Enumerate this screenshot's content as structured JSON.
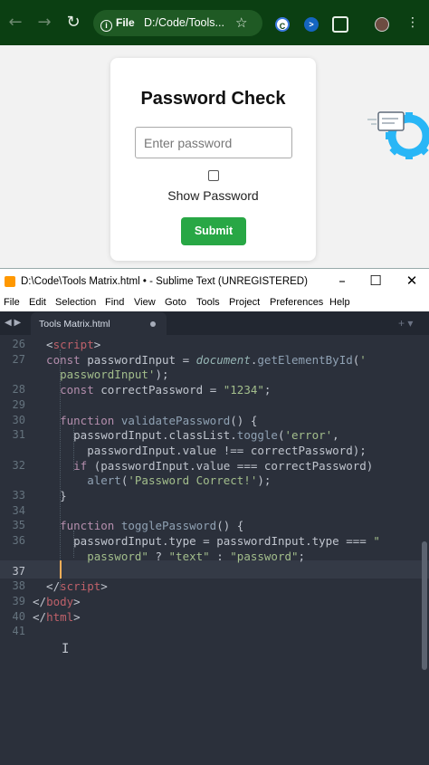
{
  "browser": {
    "url": "D:/Code/Tools...",
    "site_info": "File",
    "extension_c": "C"
  },
  "page": {
    "title": "Password Check",
    "password_placeholder": "Enter password",
    "show_password_label": "Show Password",
    "submit_label": "Submit"
  },
  "sublime": {
    "window_title": "D:\\Code\\Tools Matrix.html • - Sublime Text (UNREGISTERED)",
    "menu": [
      "File",
      "Edit",
      "Selection",
      "Find",
      "View",
      "Goto",
      "Tools",
      "Project",
      "Preferences",
      "Help"
    ],
    "tab_label": "Tools Matrix.html",
    "line_numbers": [
      "26",
      "27",
      "",
      "28",
      "29",
      "30",
      "31",
      "",
      "32",
      "",
      "33",
      "34",
      "35",
      "36",
      "",
      "37",
      "38",
      "39",
      "40",
      "41"
    ],
    "current_line": "37",
    "code": [
      [
        [
          "t-punc",
          "  <"
        ],
        [
          "t-tag",
          "script"
        ],
        [
          "t-punc",
          ">"
        ]
      ],
      [
        [
          "t-kw",
          "  const "
        ],
        [
          "t-var",
          "passwordInput "
        ],
        [
          "t-op",
          "= "
        ],
        [
          "t-it",
          "document"
        ],
        [
          "t-punc",
          "."
        ],
        [
          "t-fn",
          "getElementById"
        ],
        [
          "t-punc",
          "("
        ],
        [
          "t-str",
          "'"
        ]
      ],
      [
        [
          "t-str",
          "    passwordInput'"
        ],
        [
          "t-punc",
          ");"
        ]
      ],
      [
        [
          "t-kw",
          "    const "
        ],
        [
          "t-var",
          "correctPassword "
        ],
        [
          "t-op",
          "= "
        ],
        [
          "t-str",
          "\"1234\""
        ],
        [
          "t-punc",
          ";"
        ]
      ],
      [
        [
          "t-var",
          ""
        ]
      ],
      [
        [
          "t-kw",
          "    function "
        ],
        [
          "t-fn",
          "validatePassword"
        ],
        [
          "t-punc",
          "() {"
        ]
      ],
      [
        [
          "t-var",
          "      passwordInput"
        ],
        [
          "t-punc",
          "."
        ],
        [
          "t-var",
          "classList"
        ],
        [
          "t-punc",
          "."
        ],
        [
          "t-fn",
          "toggle"
        ],
        [
          "t-punc",
          "("
        ],
        [
          "t-str",
          "'error'"
        ],
        [
          "t-punc",
          ","
        ]
      ],
      [
        [
          "t-var",
          "        passwordInput"
        ],
        [
          "t-punc",
          "."
        ],
        [
          "t-var",
          "value "
        ],
        [
          "t-op",
          "!== "
        ],
        [
          "t-var",
          "correctPassword"
        ],
        [
          "t-punc",
          ");"
        ]
      ],
      [
        [
          "t-kw",
          "      if "
        ],
        [
          "t-punc",
          "("
        ],
        [
          "t-var",
          "passwordInput"
        ],
        [
          "t-punc",
          "."
        ],
        [
          "t-var",
          "value "
        ],
        [
          "t-op",
          "=== "
        ],
        [
          "t-var",
          "correctPassword"
        ],
        [
          "t-punc",
          ")"
        ]
      ],
      [
        [
          "t-fn",
          "        alert"
        ],
        [
          "t-punc",
          "("
        ],
        [
          "t-str",
          "'Password Correct!'"
        ],
        [
          "t-punc",
          ");"
        ]
      ],
      [
        [
          "t-punc",
          "    }"
        ]
      ],
      [
        [
          "t-var",
          ""
        ]
      ],
      [
        [
          "t-kw",
          "    function "
        ],
        [
          "t-fn",
          "togglePassword"
        ],
        [
          "t-punc",
          "() {"
        ]
      ],
      [
        [
          "t-var",
          "      passwordInput"
        ],
        [
          "t-punc",
          "."
        ],
        [
          "t-var",
          "type "
        ],
        [
          "t-op",
          "= "
        ],
        [
          "t-var",
          "passwordInput"
        ],
        [
          "t-punc",
          "."
        ],
        [
          "t-var",
          "type "
        ],
        [
          "t-op",
          "=== "
        ],
        [
          "t-str",
          "\""
        ]
      ],
      [
        [
          "t-str",
          "        password\" "
        ],
        [
          "t-op",
          "? "
        ],
        [
          "t-str",
          "\"text\" "
        ],
        [
          "t-op",
          ": "
        ],
        [
          "t-str",
          "\"password\""
        ],
        [
          "t-punc",
          ";"
        ]
      ],
      [
        [
          "t-var",
          ""
        ]
      ],
      [
        [
          "t-punc",
          "  </"
        ],
        [
          "t-tag",
          "script"
        ],
        [
          "t-punc",
          ">"
        ]
      ],
      [
        [
          "t-punc",
          "</"
        ],
        [
          "t-tag",
          "body"
        ],
        [
          "t-punc",
          ">"
        ]
      ],
      [
        [
          "t-punc",
          "</"
        ],
        [
          "t-tag",
          "html"
        ],
        [
          "t-punc",
          ">"
        ]
      ],
      [
        [
          "t-var",
          ""
        ]
      ]
    ]
  }
}
